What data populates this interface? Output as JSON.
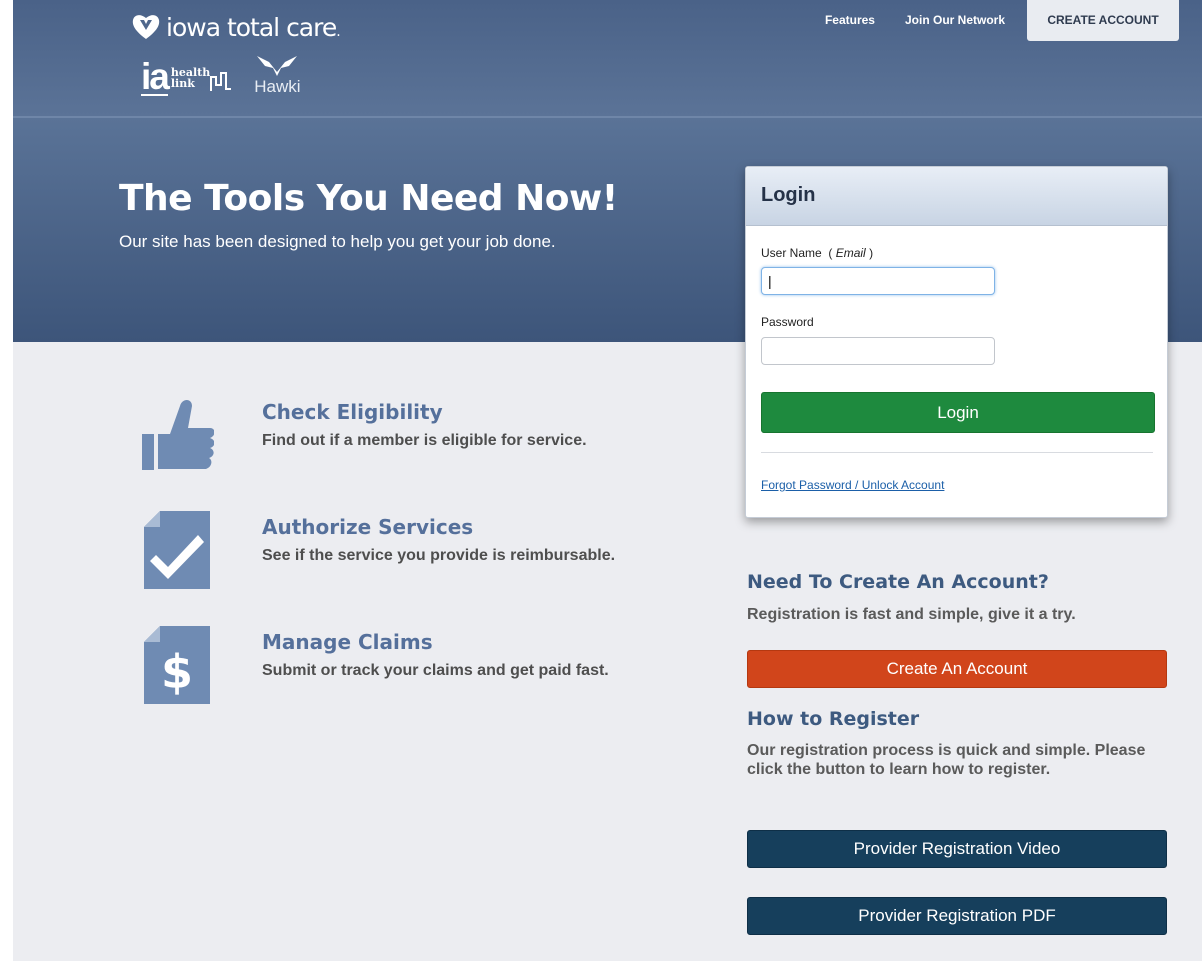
{
  "header": {
    "brand": "iowa total care",
    "brand_dot": ".",
    "ia_letters": "ia",
    "ia_words_line1": "health",
    "ia_words_line2": "link",
    "hawki": "Hawki",
    "nav": {
      "features": "Features",
      "join": "Join Our Network",
      "create": "CREATE ACCOUNT"
    }
  },
  "hero": {
    "title": "The Tools You Need Now!",
    "subtitle": "Our site has been designed to help you get your job done."
  },
  "features": [
    {
      "title": "Check Eligibility",
      "desc": "Find out if a member is eligible for service.",
      "icon": "thumbs-up-icon"
    },
    {
      "title": "Authorize Services",
      "desc": "See if the service you provide is reimbursable.",
      "icon": "document-check-icon"
    },
    {
      "title": "Manage Claims",
      "desc": "Submit or track your claims and get paid fast.",
      "icon": "document-dollar-icon"
    }
  ],
  "login": {
    "title": "Login",
    "username_label": "User Name",
    "username_hint": "Email",
    "username_open": "(",
    "username_close": ")",
    "username_value": "|",
    "password_label": "Password",
    "password_value": "",
    "submit": "Login",
    "forgot": "Forgot Password / Unlock Account"
  },
  "register": {
    "need_heading": "Need To Create An Account?",
    "need_text": "Registration is fast and simple, give it a try.",
    "create_button": "Create An Account",
    "how_heading": "How to Register",
    "how_text": "Our registration process is quick and simple. Please click the button to learn how to register.",
    "video_button": "Provider Registration Video",
    "pdf_button": "Provider Registration PDF"
  },
  "colors": {
    "header": "#4f678c",
    "accent_green": "#1e8a3e",
    "accent_orange": "#d1451b",
    "accent_navy": "#163f5c",
    "feature_title": "#55709b"
  }
}
